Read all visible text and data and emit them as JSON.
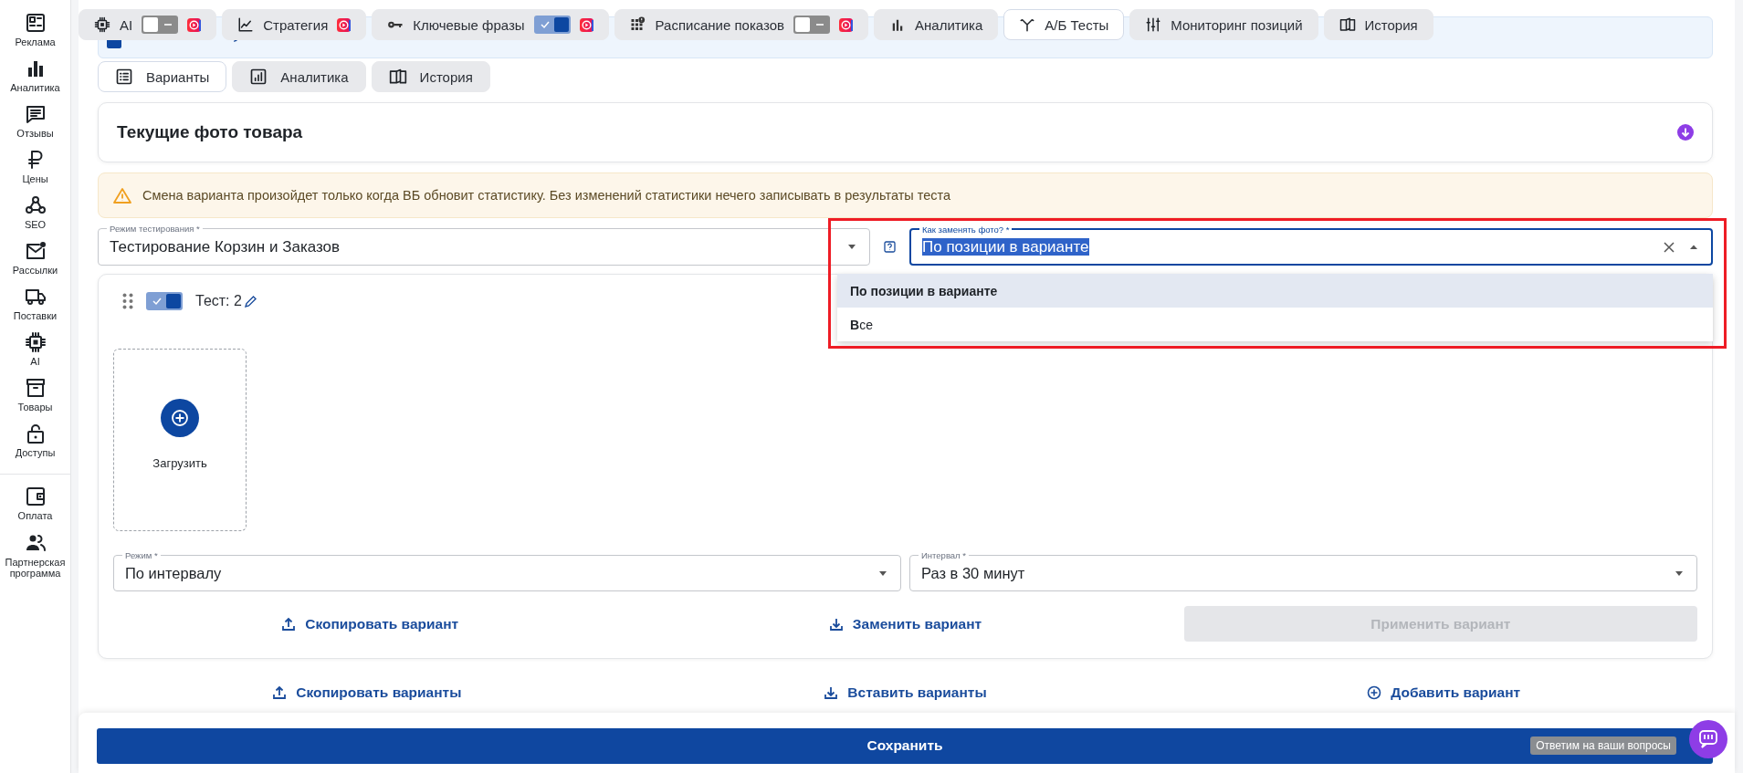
{
  "sidebar": {
    "items": [
      {
        "label": "Реклама"
      },
      {
        "label": "Аналитика"
      },
      {
        "label": "Отзывы"
      },
      {
        "label": "Цены"
      },
      {
        "label": "SEO"
      },
      {
        "label": "Рассылки"
      },
      {
        "label": "Поставки"
      },
      {
        "label": "AI"
      },
      {
        "label": "Товары"
      },
      {
        "label": "Доступы"
      }
    ],
    "bottom_items": [
      {
        "label": "Оплата"
      },
      {
        "label": "Партнерская программа"
      }
    ]
  },
  "top_tabs": [
    {
      "label": "AI",
      "selected": false,
      "switch_on": false,
      "video": true
    },
    {
      "label": "Стратегия",
      "selected": false,
      "video": true
    },
    {
      "label": "Ключевые фразы",
      "selected": false,
      "switch_on": true,
      "video": true
    },
    {
      "label": "Расписание показов",
      "selected": false,
      "switch_on": false,
      "video": true
    },
    {
      "label": "Аналитика",
      "selected": false,
      "video": false
    },
    {
      "label": "А/Б Тесты",
      "selected": true,
      "video": false
    },
    {
      "label": "Мониторинг позиций",
      "selected": false,
      "video": false
    },
    {
      "label": "История",
      "selected": false,
      "video": false
    }
  ],
  "sub_tabs": [
    {
      "label": "Варианты",
      "selected": true
    },
    {
      "label": "Аналитика",
      "selected": false
    },
    {
      "label": "История",
      "selected": false
    }
  ],
  "photos_section": {
    "title": "Текущие фото товара"
  },
  "warning": {
    "text": "Смена варианта произойдет только когда ВБ обновит статистику. Без изменений статистики нечего записывать в результаты теста"
  },
  "test_mode_field": {
    "label": "Режим тестирования *",
    "value": "Тестирование Корзин и Заказов"
  },
  "replace_field": {
    "label": "Как заменять фото? *",
    "value": "По позиции в варианте",
    "open": true,
    "options": [
      {
        "label": "По позиции в варианте",
        "selected": true
      },
      {
        "label": "**В**се",
        "selected": false
      }
    ]
  },
  "variant": {
    "enabled": true,
    "title": "Тест: 2",
    "upload_label": "Загрузить",
    "mode_field": {
      "label": "Режим *",
      "value": "По интервалу"
    },
    "interval_field": {
      "label": "Интервал *",
      "value": "Раз в 30 минут"
    },
    "actions": [
      {
        "label": "Скопировать вариант",
        "kind": "upload",
        "disabled": false
      },
      {
        "label": "Заменить вариант",
        "kind": "download",
        "disabled": false
      },
      {
        "label": "Применить вариант",
        "kind": "primary",
        "disabled": true
      }
    ]
  },
  "list_actions": [
    {
      "label": "Скопировать варианты",
      "kind": "upload"
    },
    {
      "label": "Вставить варианты",
      "kind": "download"
    },
    {
      "label": "Добавить вариант",
      "kind": "add"
    }
  ],
  "save_button": {
    "label": "Сохранить"
  },
  "chat": {
    "tooltip": "Ответим на ваши вопросы"
  }
}
